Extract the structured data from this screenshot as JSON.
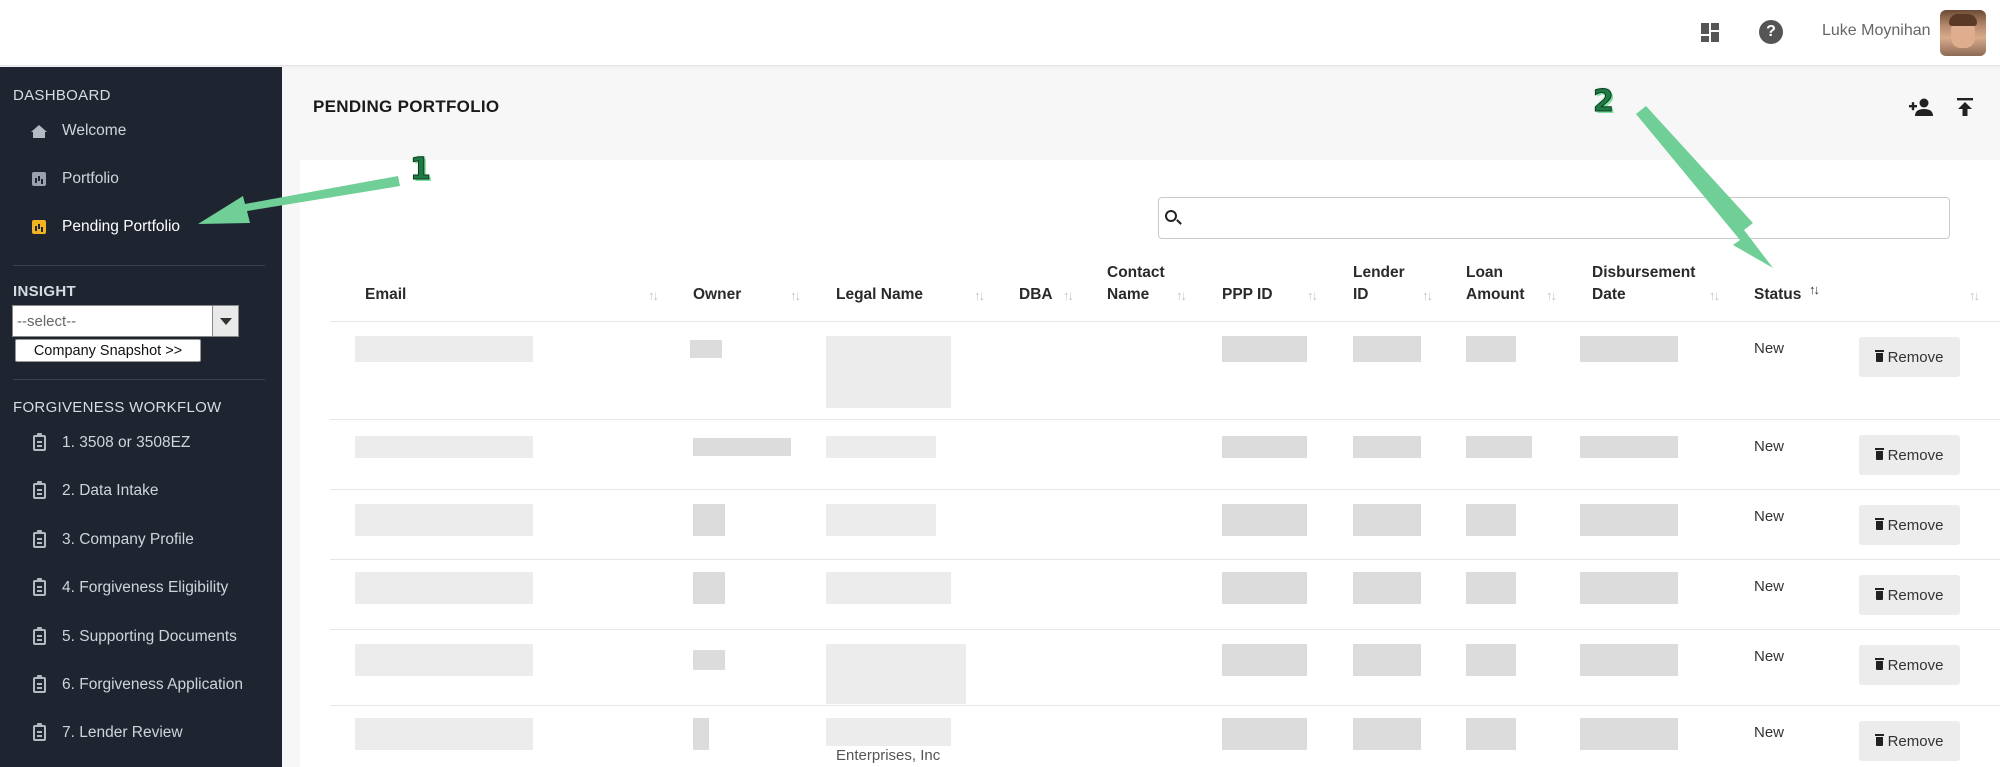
{
  "header": {
    "user_name": "Luke Moynihan",
    "icons": [
      "dashboard-icon",
      "help-icon"
    ]
  },
  "sidebar": {
    "dashboard_heading": "DASHBOARD",
    "dashboard_items": [
      {
        "label": "Welcome",
        "icon": "home-icon"
      },
      {
        "label": "Portfolio",
        "icon": "bar-chart-icon"
      },
      {
        "label": "Pending Portfolio",
        "icon": "bar-chart-icon",
        "active": true
      }
    ],
    "insight_heading": "INSIGHT",
    "insight_select_value": "--select--",
    "snapshot_button": "Company Snapshot >>",
    "workflow_heading": "FORGIVENESS WORKFLOW",
    "workflow_items": [
      {
        "label": "1. 3508 or 3508EZ"
      },
      {
        "label": "2. Data Intake"
      },
      {
        "label": "3. Company Profile"
      },
      {
        "label": "4. Forgiveness Eligibility"
      },
      {
        "label": "5. Supporting Documents"
      },
      {
        "label": "6. Forgiveness Application"
      },
      {
        "label": "7. Lender Review"
      }
    ]
  },
  "main": {
    "title": "PENDING PORTFOLIO",
    "search_value": "",
    "columns": [
      {
        "line1": "Email",
        "line2": ""
      },
      {
        "line1": "Owner",
        "line2": ""
      },
      {
        "line1": "Legal Name",
        "line2": ""
      },
      {
        "line1": "DBA",
        "line2": ""
      },
      {
        "line1": "Contact",
        "line2": "Name"
      },
      {
        "line1": "PPP ID",
        "line2": ""
      },
      {
        "line1": "Lender",
        "line2": "ID"
      },
      {
        "line1": "Loan",
        "line2": "Amount"
      },
      {
        "line1": "Disbursement",
        "line2": "Date"
      },
      {
        "line1": "Status",
        "line2": ""
      }
    ],
    "sort_glyph": "↑↓",
    "rows": [
      {
        "status": "New",
        "action": "Remove"
      },
      {
        "status": "New",
        "action": "Remove"
      },
      {
        "status": "New",
        "action": "Remove"
      },
      {
        "status": "New",
        "action": "Remove"
      },
      {
        "status": "New",
        "action": "Remove"
      },
      {
        "status": "New",
        "action": "Remove"
      }
    ],
    "partial_text": "Enterprises, Inc"
  },
  "annotations": {
    "labels": [
      "1",
      "2"
    ],
    "color": "#6fcf97"
  }
}
